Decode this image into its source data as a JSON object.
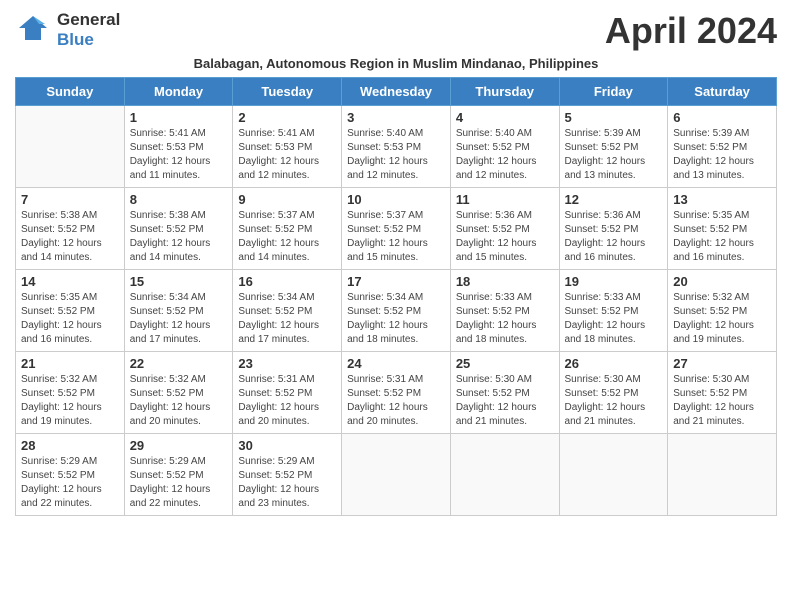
{
  "logo": {
    "general": "General",
    "blue": "Blue"
  },
  "title": "April 2024",
  "subtitle": "Balabagan, Autonomous Region in Muslim Mindanao, Philippines",
  "days_of_week": [
    "Sunday",
    "Monday",
    "Tuesday",
    "Wednesday",
    "Thursday",
    "Friday",
    "Saturday"
  ],
  "weeks": [
    [
      {
        "date": "",
        "info": ""
      },
      {
        "date": "1",
        "info": "Sunrise: 5:41 AM\nSunset: 5:53 PM\nDaylight: 12 hours\nand 11 minutes."
      },
      {
        "date": "2",
        "info": "Sunrise: 5:41 AM\nSunset: 5:53 PM\nDaylight: 12 hours\nand 12 minutes."
      },
      {
        "date": "3",
        "info": "Sunrise: 5:40 AM\nSunset: 5:53 PM\nDaylight: 12 hours\nand 12 minutes."
      },
      {
        "date": "4",
        "info": "Sunrise: 5:40 AM\nSunset: 5:52 PM\nDaylight: 12 hours\nand 12 minutes."
      },
      {
        "date": "5",
        "info": "Sunrise: 5:39 AM\nSunset: 5:52 PM\nDaylight: 12 hours\nand 13 minutes."
      },
      {
        "date": "6",
        "info": "Sunrise: 5:39 AM\nSunset: 5:52 PM\nDaylight: 12 hours\nand 13 minutes."
      }
    ],
    [
      {
        "date": "7",
        "info": "Sunrise: 5:38 AM\nSunset: 5:52 PM\nDaylight: 12 hours\nand 14 minutes."
      },
      {
        "date": "8",
        "info": "Sunrise: 5:38 AM\nSunset: 5:52 PM\nDaylight: 12 hours\nand 14 minutes."
      },
      {
        "date": "9",
        "info": "Sunrise: 5:37 AM\nSunset: 5:52 PM\nDaylight: 12 hours\nand 14 minutes."
      },
      {
        "date": "10",
        "info": "Sunrise: 5:37 AM\nSunset: 5:52 PM\nDaylight: 12 hours\nand 15 minutes."
      },
      {
        "date": "11",
        "info": "Sunrise: 5:36 AM\nSunset: 5:52 PM\nDaylight: 12 hours\nand 15 minutes."
      },
      {
        "date": "12",
        "info": "Sunrise: 5:36 AM\nSunset: 5:52 PM\nDaylight: 12 hours\nand 16 minutes."
      },
      {
        "date": "13",
        "info": "Sunrise: 5:35 AM\nSunset: 5:52 PM\nDaylight: 12 hours\nand 16 minutes."
      }
    ],
    [
      {
        "date": "14",
        "info": "Sunrise: 5:35 AM\nSunset: 5:52 PM\nDaylight: 12 hours\nand 16 minutes."
      },
      {
        "date": "15",
        "info": "Sunrise: 5:34 AM\nSunset: 5:52 PM\nDaylight: 12 hours\nand 17 minutes."
      },
      {
        "date": "16",
        "info": "Sunrise: 5:34 AM\nSunset: 5:52 PM\nDaylight: 12 hours\nand 17 minutes."
      },
      {
        "date": "17",
        "info": "Sunrise: 5:34 AM\nSunset: 5:52 PM\nDaylight: 12 hours\nand 18 minutes."
      },
      {
        "date": "18",
        "info": "Sunrise: 5:33 AM\nSunset: 5:52 PM\nDaylight: 12 hours\nand 18 minutes."
      },
      {
        "date": "19",
        "info": "Sunrise: 5:33 AM\nSunset: 5:52 PM\nDaylight: 12 hours\nand 18 minutes."
      },
      {
        "date": "20",
        "info": "Sunrise: 5:32 AM\nSunset: 5:52 PM\nDaylight: 12 hours\nand 19 minutes."
      }
    ],
    [
      {
        "date": "21",
        "info": "Sunrise: 5:32 AM\nSunset: 5:52 PM\nDaylight: 12 hours\nand 19 minutes."
      },
      {
        "date": "22",
        "info": "Sunrise: 5:32 AM\nSunset: 5:52 PM\nDaylight: 12 hours\nand 20 minutes."
      },
      {
        "date": "23",
        "info": "Sunrise: 5:31 AM\nSunset: 5:52 PM\nDaylight: 12 hours\nand 20 minutes."
      },
      {
        "date": "24",
        "info": "Sunrise: 5:31 AM\nSunset: 5:52 PM\nDaylight: 12 hours\nand 20 minutes."
      },
      {
        "date": "25",
        "info": "Sunrise: 5:30 AM\nSunset: 5:52 PM\nDaylight: 12 hours\nand 21 minutes."
      },
      {
        "date": "26",
        "info": "Sunrise: 5:30 AM\nSunset: 5:52 PM\nDaylight: 12 hours\nand 21 minutes."
      },
      {
        "date": "27",
        "info": "Sunrise: 5:30 AM\nSunset: 5:52 PM\nDaylight: 12 hours\nand 21 minutes."
      }
    ],
    [
      {
        "date": "28",
        "info": "Sunrise: 5:29 AM\nSunset: 5:52 PM\nDaylight: 12 hours\nand 22 minutes."
      },
      {
        "date": "29",
        "info": "Sunrise: 5:29 AM\nSunset: 5:52 PM\nDaylight: 12 hours\nand 22 minutes."
      },
      {
        "date": "30",
        "info": "Sunrise: 5:29 AM\nSunset: 5:52 PM\nDaylight: 12 hours\nand 23 minutes."
      },
      {
        "date": "",
        "info": ""
      },
      {
        "date": "",
        "info": ""
      },
      {
        "date": "",
        "info": ""
      },
      {
        "date": "",
        "info": ""
      }
    ]
  ]
}
